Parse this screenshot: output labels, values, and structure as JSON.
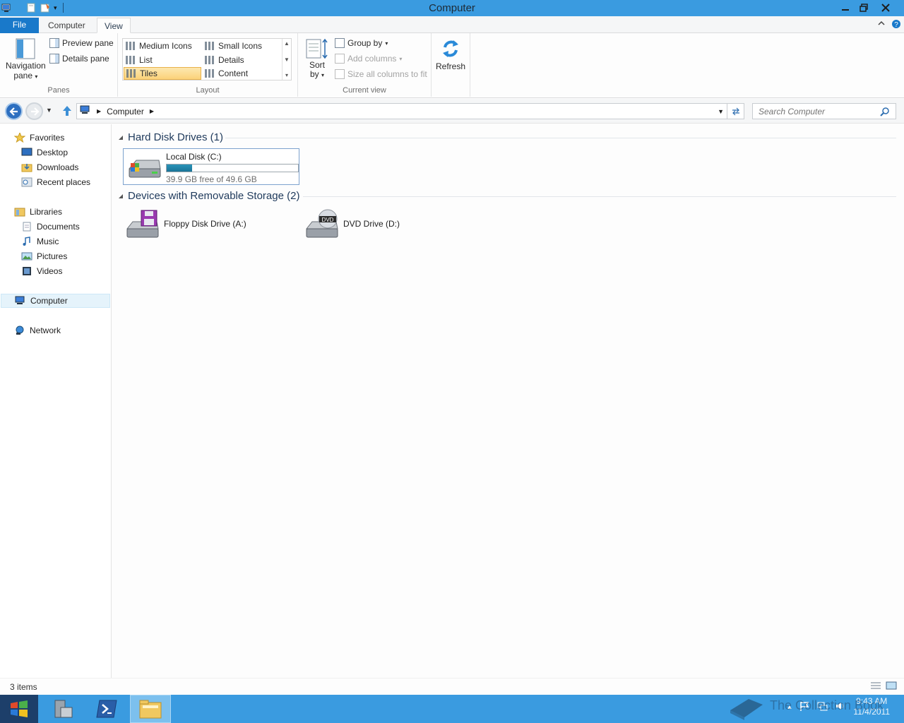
{
  "window": {
    "title": "Computer",
    "controls": [
      "minimize",
      "restore",
      "close"
    ]
  },
  "ribbon_tabs": [
    {
      "label": "File"
    },
    {
      "label": "Computer"
    },
    {
      "label": "View",
      "active": true
    }
  ],
  "ribbon": {
    "panes": {
      "group_label": "Panes",
      "navigation_pane": "Navigation",
      "navigation_pane_2": "pane",
      "preview_pane": "Preview pane",
      "details_pane": "Details pane"
    },
    "layout": {
      "group_label": "Layout",
      "options": [
        "Medium Icons",
        "Small Icons",
        "List",
        "Details",
        "Tiles",
        "Content"
      ],
      "selected": "Tiles"
    },
    "current_view": {
      "group_label": "Current view",
      "sort_by": "Sort",
      "sort_by_2": "by",
      "group_by": "Group by",
      "add_columns": "Add columns",
      "size_columns": "Size all columns to fit"
    },
    "refresh": "Refresh"
  },
  "address": {
    "crumbs": [
      "Computer"
    ],
    "search_placeholder": "Search Computer"
  },
  "navpane": {
    "favorites": {
      "label": "Favorites",
      "items": [
        "Desktop",
        "Downloads",
        "Recent places"
      ]
    },
    "libraries": {
      "label": "Libraries",
      "items": [
        "Documents",
        "Music",
        "Pictures",
        "Videos"
      ]
    },
    "computer": "Computer",
    "network": "Network"
  },
  "content": {
    "groups": [
      {
        "header": "Hard Disk Drives (1)",
        "items": [
          {
            "name": "Local Disk (C:)",
            "free_text": "39.9 GB free of 49.6 GB",
            "used_fraction": 0.196
          }
        ]
      },
      {
        "header": "Devices with Removable Storage (2)",
        "items": [
          {
            "name": "Floppy Disk Drive (A:)"
          },
          {
            "name": "DVD Drive (D:)"
          }
        ]
      }
    ]
  },
  "statusbar": {
    "count": "3 items"
  },
  "taskbar": {
    "clock_time": "9:43 AM",
    "clock_date": "11/4/2011",
    "watermark": "The Collection Book"
  },
  "colors": {
    "titlebar": "#3a9be0",
    "file_tab": "#1979ca",
    "taskbar": "#3a9be0",
    "group_header": "#1e395b",
    "bar_fill": "#1a7497"
  }
}
